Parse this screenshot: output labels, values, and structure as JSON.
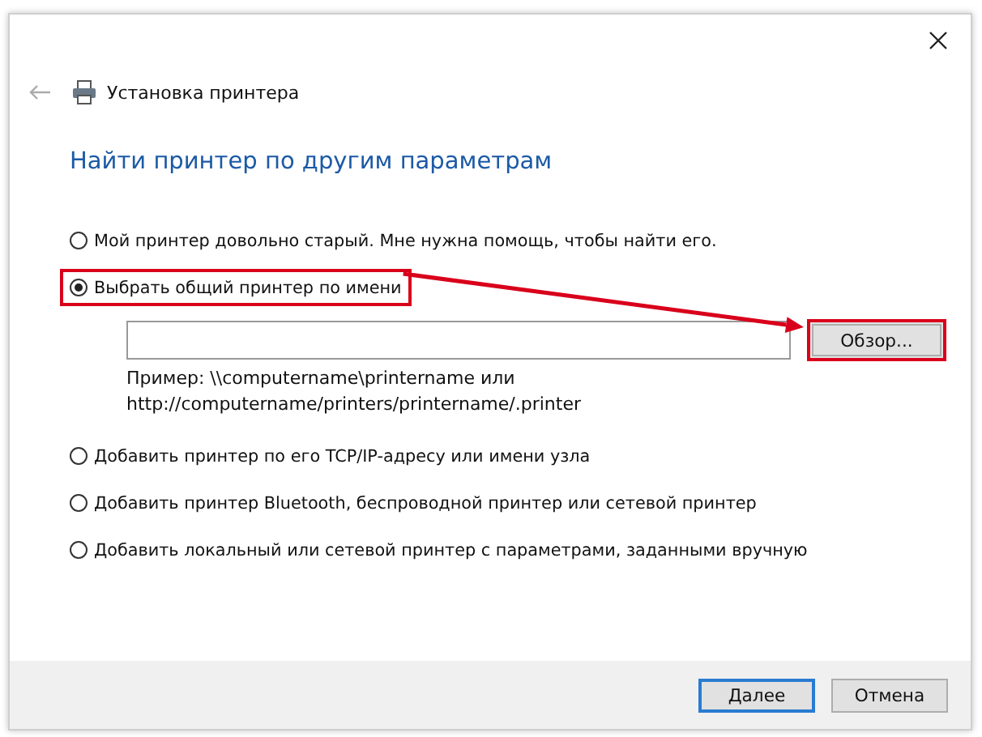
{
  "window": {
    "title": "Установка принтера"
  },
  "heading": "Найти принтер по другим параметрам",
  "options": [
    {
      "kind": "radio",
      "label": "Мой принтер довольно старый. Мне нужна помощь, чтобы найти его.",
      "selected": false,
      "highlighted": false
    },
    {
      "kind": "radio",
      "label": "Выбрать общий принтер по имени",
      "selected": true,
      "highlighted": true
    },
    {
      "kind": "name_input",
      "browse_button": {
        "label": "Обзор...",
        "highlighted": true
      },
      "example": [
        "Пример: \\\\computername\\printername или",
        "http://computername/printers/printername/.printer"
      ]
    },
    {
      "kind": "radio",
      "label": "Добавить принтер по его TCP/IP-адресу или имени узла",
      "selected": false,
      "highlighted": false
    },
    {
      "kind": "radio",
      "label": "Добавить принтер Bluetooth, беспроводной принтер или сетевой принтер",
      "selected": false,
      "highlighted": false
    },
    {
      "kind": "radio",
      "label": "Добавить локальный или сетевой принтер с параметрами, заданными вручную",
      "selected": false,
      "highlighted": false
    }
  ],
  "annotation_arrow": true,
  "buttons": [
    {
      "label": "Далее",
      "default": true
    },
    {
      "label": "Отмена",
      "default": false
    }
  ]
}
